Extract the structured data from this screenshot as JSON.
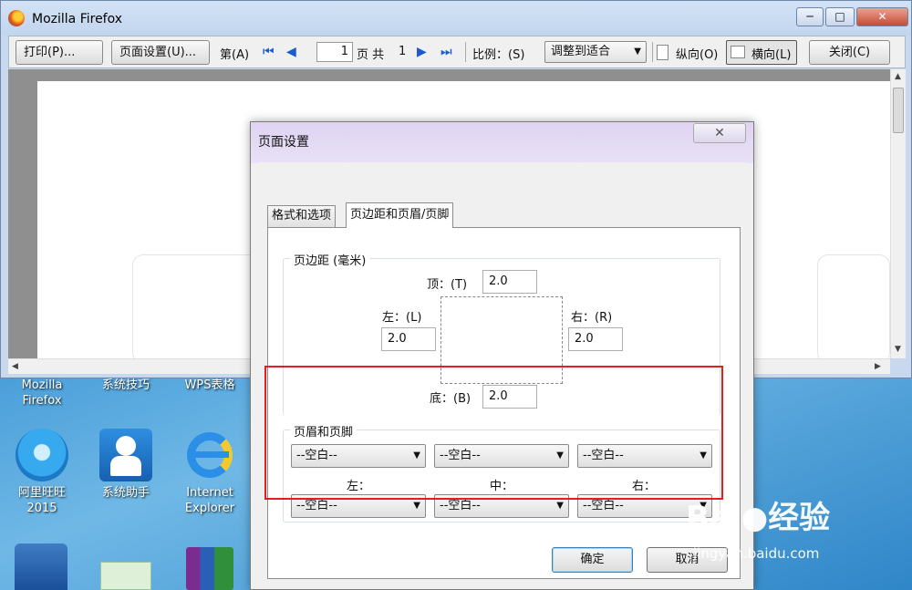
{
  "firefox": {
    "title": "Mozilla Firefox",
    "toolbar": {
      "print_label": "打印(P)...",
      "page_setup_label": "页面设置(U)...",
      "page_prefix": "第(A)",
      "current_page": "1",
      "page_of": "页 共",
      "total_pages": "1",
      "scale_label": "比例：(S)",
      "scale_value": "调整到适合",
      "portrait_label": "纵向(O)",
      "landscape_label": "横向(L)",
      "close_label": "关闭(C)"
    }
  },
  "dialog": {
    "title": "页面设置",
    "tabs": [
      {
        "label": "格式和选项"
      },
      {
        "label": "页边距和页眉/页脚"
      }
    ],
    "margins": {
      "group_label": "页边距 (毫米)",
      "top_label": "顶：(T)",
      "top_value": "2.0",
      "left_label": "左：(L)",
      "left_value": "2.0",
      "right_label": "右：(R)",
      "right_value": "2.0",
      "bottom_label": "底：(B)",
      "bottom_value": "2.0"
    },
    "headers_footers": {
      "group_label": "页眉和页脚",
      "header_left": "--空白--",
      "header_center": "--空白--",
      "header_right": "--空白--",
      "col_left_label": "左：",
      "col_center_label": "中：",
      "col_right_label": "右：",
      "footer_left": "--空白--",
      "footer_center": "--空白--",
      "footer_right": "--空白--"
    },
    "ok_label": "确定",
    "cancel_label": "取消"
  },
  "desktop": {
    "icons": [
      {
        "label": "Mozilla\nFirefox"
      },
      {
        "label": "系统技巧"
      },
      {
        "label": "WPS表格"
      },
      {
        "label": "阿里旺旺\n2015"
      },
      {
        "label": "系统助手"
      },
      {
        "label": "Internet\nExplorer"
      }
    ]
  },
  "watermark": {
    "brand": "Bai",
    "brand2": "经验",
    "url": "jingyan.baidu.com"
  },
  "colors": {
    "highlight": "#e02020",
    "accent_blue": "#1a5bd1"
  }
}
